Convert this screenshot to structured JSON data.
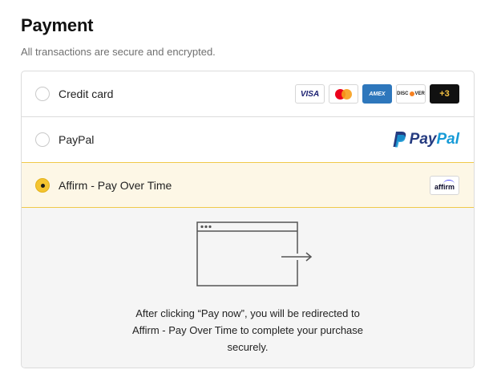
{
  "header": {
    "title": "Payment",
    "subtitle": "All transactions are secure and encrypted."
  },
  "options": [
    {
      "label": "Credit card",
      "selected": false,
      "card_logos": [
        "VISA",
        "mastercard",
        "AMEX",
        "DISCOVER"
      ],
      "more_label": "+3"
    },
    {
      "label": "PayPal",
      "selected": false,
      "logo_text_1": "Pay",
      "logo_text_2": "Pal"
    },
    {
      "label": "Affirm - Pay Over Time",
      "selected": true,
      "logo_text": "affirm"
    }
  ],
  "redirect_panel": {
    "line1": "After clicking “Pay now”, you will be redirected to",
    "line2": "Affirm - Pay Over Time to complete your purchase",
    "line3": "securely."
  },
  "colors": {
    "selected_bg": "#fdf7e6",
    "selected_border": "#f0c94a",
    "radio_selected": "#f4c430",
    "paypal_dark": "#253b80",
    "paypal_light": "#179bd7"
  }
}
